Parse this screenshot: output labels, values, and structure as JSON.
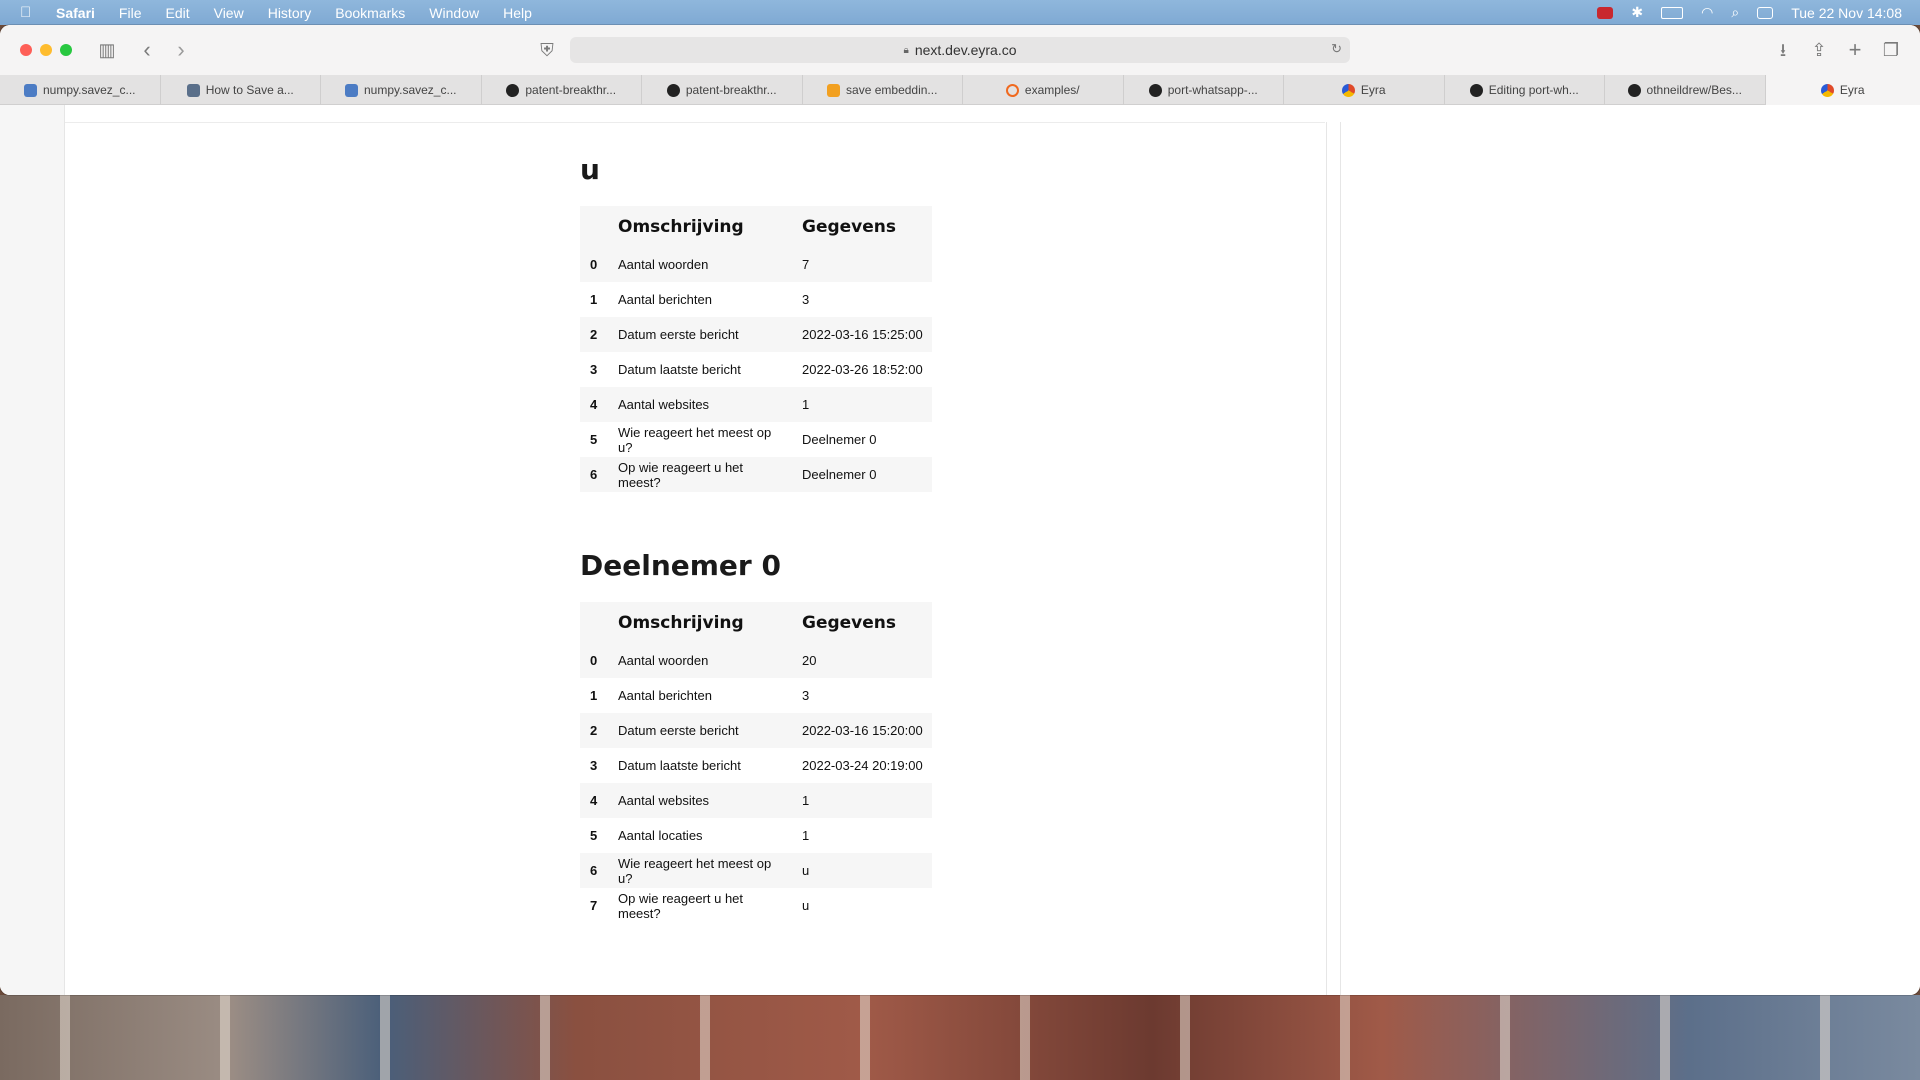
{
  "menubar": {
    "app": "Safari",
    "items": [
      "File",
      "Edit",
      "View",
      "History",
      "Bookmarks",
      "Window",
      "Help"
    ],
    "clock": "Tue 22 Nov  14:08"
  },
  "toolbar": {
    "url": "next.dev.eyra.co"
  },
  "tabs": [
    {
      "label": "numpy.savez_c...",
      "icon_color": "#4c7cc4"
    },
    {
      "label": "How to Save a...",
      "icon_color": "#5a6f8a"
    },
    {
      "label": "numpy.savez_c...",
      "icon_color": "#4c7cc4"
    },
    {
      "label": "patent-breakthr...",
      "icon_color": "#222222"
    },
    {
      "label": "patent-breakthr...",
      "icon_color": "#222222"
    },
    {
      "label": "save embeddin...",
      "icon_color": "#f2a020"
    },
    {
      "label": "examples/",
      "icon_color": "#f06a20"
    },
    {
      "label": "port-whatsapp-...",
      "icon_color": "#222222"
    },
    {
      "label": "Eyra",
      "icon_color": "#e04a2a"
    },
    {
      "label": "Editing port-wh...",
      "icon_color": "#222222"
    },
    {
      "label": "othneildrew/Bes...",
      "icon_color": "#222222"
    },
    {
      "label": "Eyra",
      "icon_color": "#e04a2a"
    }
  ],
  "sections": [
    {
      "title": "u",
      "header": {
        "desc": "Omschrijving",
        "val": "Gegevens"
      },
      "rows": [
        {
          "idx": "0",
          "desc": "Aantal woorden",
          "val": "7"
        },
        {
          "idx": "1",
          "desc": "Aantal berichten",
          "val": "3"
        },
        {
          "idx": "2",
          "desc": "Datum eerste bericht",
          "val": "2022-03-16 15:25:00"
        },
        {
          "idx": "3",
          "desc": "Datum laatste bericht",
          "val": "2022-03-26 18:52:00"
        },
        {
          "idx": "4",
          "desc": "Aantal websites",
          "val": "1"
        },
        {
          "idx": "5",
          "desc": "Wie reageert het meest op u?",
          "val": "Deelnemer 0"
        },
        {
          "idx": "6",
          "desc": "Op wie reageert u het meest?",
          "val": "Deelnemer 0"
        }
      ]
    },
    {
      "title": "Deelnemer 0",
      "header": {
        "desc": "Omschrijving",
        "val": "Gegevens"
      },
      "rows": [
        {
          "idx": "0",
          "desc": "Aantal woorden",
          "val": "20"
        },
        {
          "idx": "1",
          "desc": "Aantal berichten",
          "val": "3"
        },
        {
          "idx": "2",
          "desc": "Datum eerste bericht",
          "val": "2022-03-16 15:20:00"
        },
        {
          "idx": "3",
          "desc": "Datum laatste bericht",
          "val": "2022-03-24 20:19:00"
        },
        {
          "idx": "4",
          "desc": "Aantal websites",
          "val": "1"
        },
        {
          "idx": "5",
          "desc": "Aantal locaties",
          "val": "1"
        },
        {
          "idx": "6",
          "desc": "Wie reageert het meest op u?",
          "val": "u"
        },
        {
          "idx": "7",
          "desc": "Op wie reageert u het meest?",
          "val": "u"
        }
      ]
    }
  ]
}
